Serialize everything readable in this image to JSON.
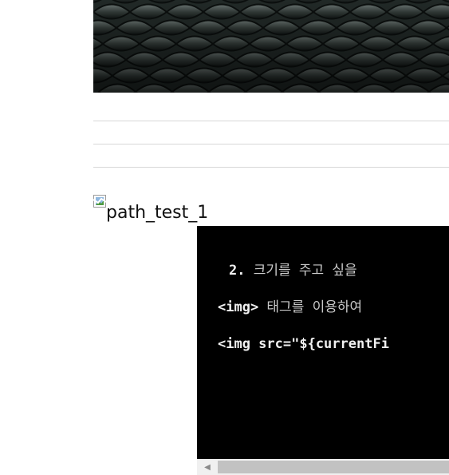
{
  "top_image": {
    "icon": "snake-scales-photo"
  },
  "broken_image": {
    "alt_text": "path_test_1",
    "icon": "broken-image-icon"
  },
  "code_screenshot": {
    "lines": [
      {
        "prefix": "2.",
        "text": " 크기를 주고 싶을"
      },
      {
        "prefix": "<img>",
        "text": " 태그를 이용하여"
      },
      {
        "prefix": "",
        "text": "<img src=\"${currentFi"
      }
    ],
    "background": "#000000"
  },
  "scrollbar": {
    "left_arrow": "◀"
  }
}
